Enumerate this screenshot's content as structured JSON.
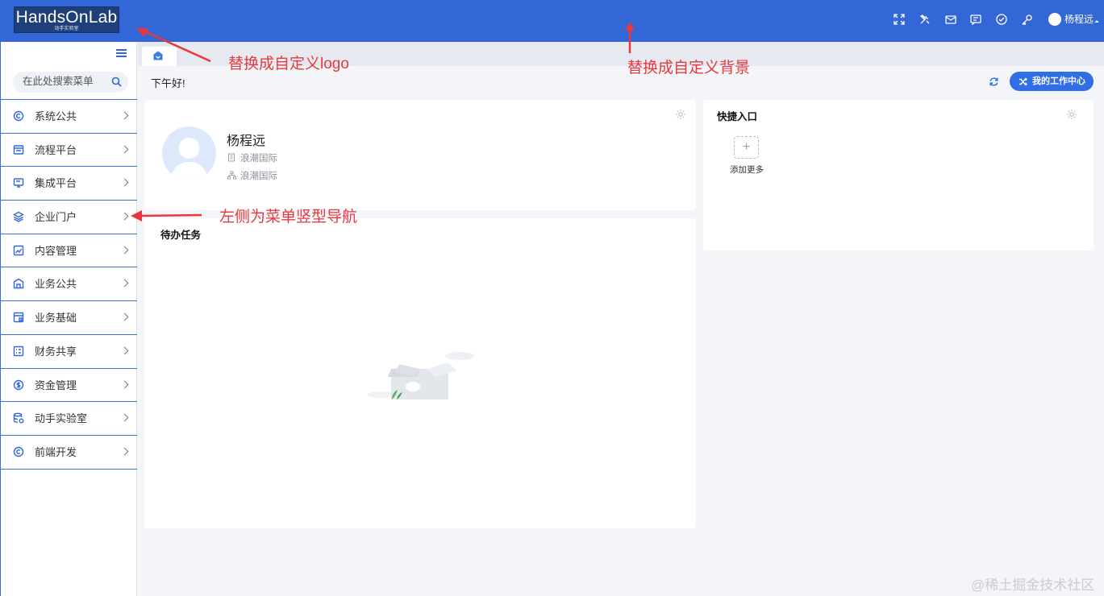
{
  "header": {
    "logo_title": "HandsOnLab",
    "logo_subtitle": "动手实验室",
    "icons": [
      "fullscreen-icon",
      "tools-icon",
      "mail-icon",
      "message-icon",
      "check-circle-icon",
      "key-icon"
    ],
    "user_name": "杨程远"
  },
  "sidebar": {
    "search_placeholder": "在此处搜索菜单",
    "items": [
      {
        "label": "系统公共",
        "icon": "system-icon"
      },
      {
        "label": "流程平台",
        "icon": "flow-icon"
      },
      {
        "label": "集成平台",
        "icon": "integration-icon"
      },
      {
        "label": "企业门户",
        "icon": "layers-icon"
      },
      {
        "label": "内容管理",
        "icon": "chart-icon"
      },
      {
        "label": "业务公共",
        "icon": "home-shield-icon"
      },
      {
        "label": "业务基础",
        "icon": "window-icon"
      },
      {
        "label": "财务共享",
        "icon": "list-icon"
      },
      {
        "label": "资金管理",
        "icon": "dollar-icon"
      },
      {
        "label": "动手实验室",
        "icon": "database-icon"
      },
      {
        "label": "前端开发",
        "icon": "copyright-icon"
      }
    ]
  },
  "main": {
    "greeting": "下午好!",
    "workcenter_label": "我的工作中心",
    "profile": {
      "name": "杨程远",
      "company": "浪潮国际",
      "department": "浪潮国际"
    },
    "todo_title": "待办任务",
    "quick_title": "快捷入口",
    "add_more_label": "添加更多"
  },
  "annotations": {
    "logo_note": "替换成自定义logo",
    "bg_note": "替换成自定义背景",
    "nav_note": "左侧为菜单竖型导航"
  },
  "watermark": "@稀土掘金技术社区",
  "colors": {
    "header_bg": "#3366d6",
    "accent": "#2f6ee6",
    "annotation": "#e8383d"
  }
}
